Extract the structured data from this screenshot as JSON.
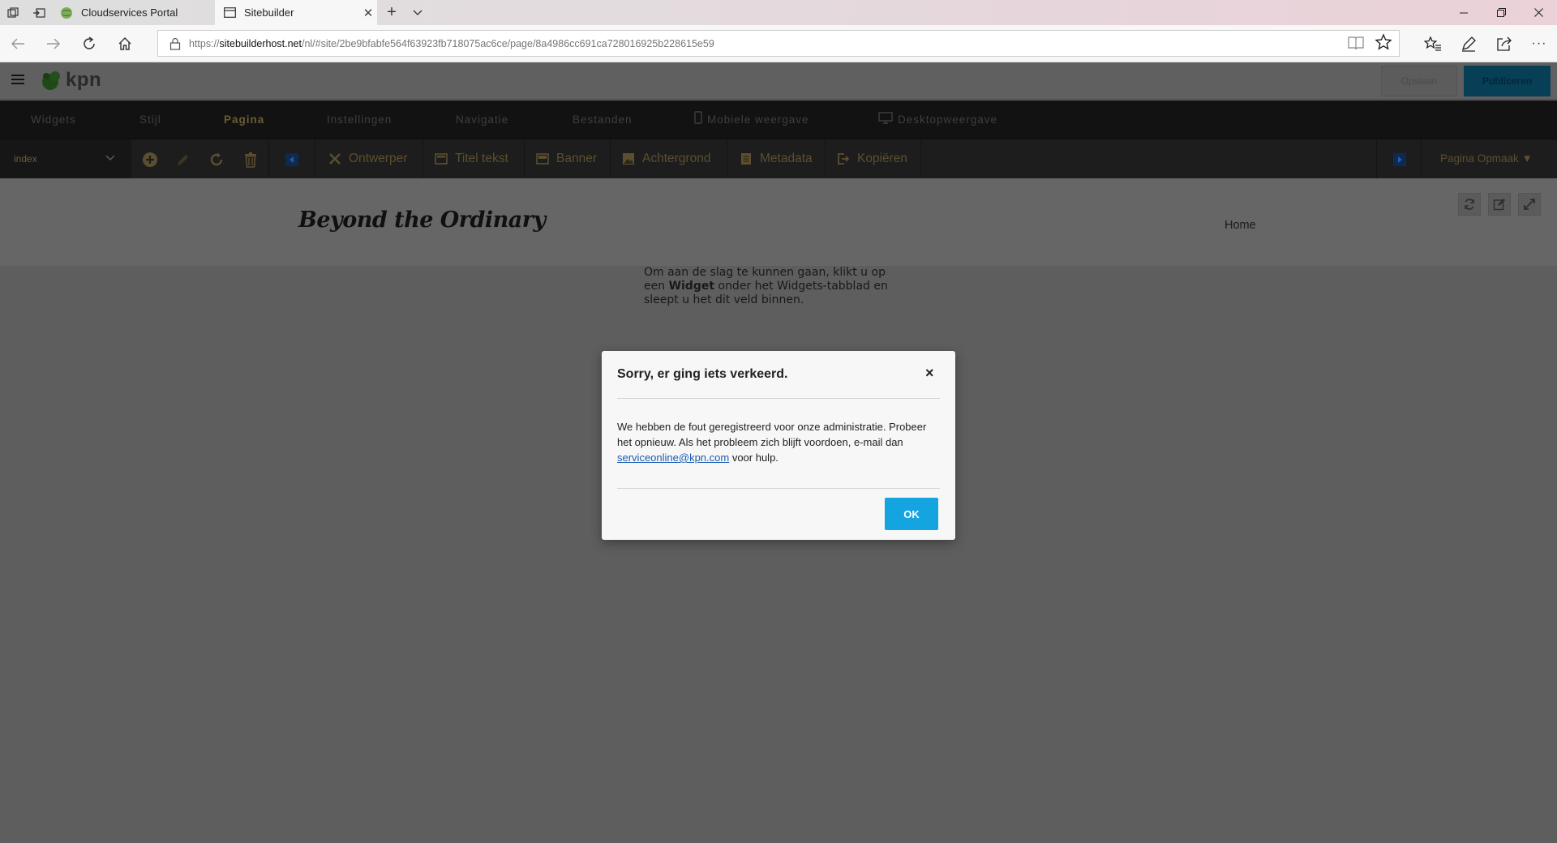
{
  "browser": {
    "tabs": [
      {
        "title": "Cloudservices Portal",
        "active": false
      },
      {
        "title": "Sitebuilder",
        "active": true
      }
    ],
    "url": {
      "scheme": "https://",
      "host": "sitebuilderhost.net",
      "path": "/nl/#site/2be9bfabfe564f63923fb718075ac6ce/page/8a4986cc691ca728016925b228615e59"
    },
    "icons": [
      "tab-actions-icon",
      "set-aside-tabs-icon",
      "new-tab-icon",
      "tab-list-icon",
      "back-icon",
      "forward-icon",
      "refresh-icon",
      "home-icon",
      "lock-icon",
      "reading-view-icon",
      "favorite-star-icon",
      "favorites-hub-icon",
      "web-note-icon",
      "share-icon",
      "more-icon",
      "minimize-icon",
      "restore-icon",
      "close-icon"
    ]
  },
  "app": {
    "logo_text": "kpn",
    "save_label": "Opslaan",
    "publish_label": "Publiceren",
    "menu": [
      "Widgets",
      "Stijl",
      "Pagina",
      "Instellingen",
      "Navigatie",
      "Bestanden",
      "Mobiele weergave",
      "Desktopweergave"
    ],
    "active_menu": "Pagina",
    "toolbar": {
      "page_select_value": "index",
      "items": [
        "Ontwerper",
        "Titel tekst",
        "Banner",
        "Achtergrond",
        "Metadata",
        "Kopiëren"
      ],
      "layout_menu": "Pagina Opmaak ▼"
    }
  },
  "preview": {
    "site_logo": "Beyond the Ordinary",
    "nav_home": "Home",
    "hint": {
      "part1": "Om aan de slag te kunnen gaan, klikt u op een ",
      "bold": "Widget",
      "part2": " onder het Widgets-tabblad en sleept u het dit veld binnen."
    }
  },
  "modal": {
    "title": "Sorry, er ging iets verkeerd.",
    "close": "×",
    "body_part1": "We hebben de fout geregistreerd voor onze administratie. Probeer het opnieuw. Als het probleem zich blijft voordoen, e-mail dan ",
    "email": "serviceonline@kpn.com",
    "body_part2": " voor hulp.",
    "ok_label": "OK"
  },
  "colors": {
    "ok_button": "#14a4e0",
    "publish_button": "#063f56",
    "active_menu": "#6b5b33",
    "overlay": "#5e5e5e"
  }
}
